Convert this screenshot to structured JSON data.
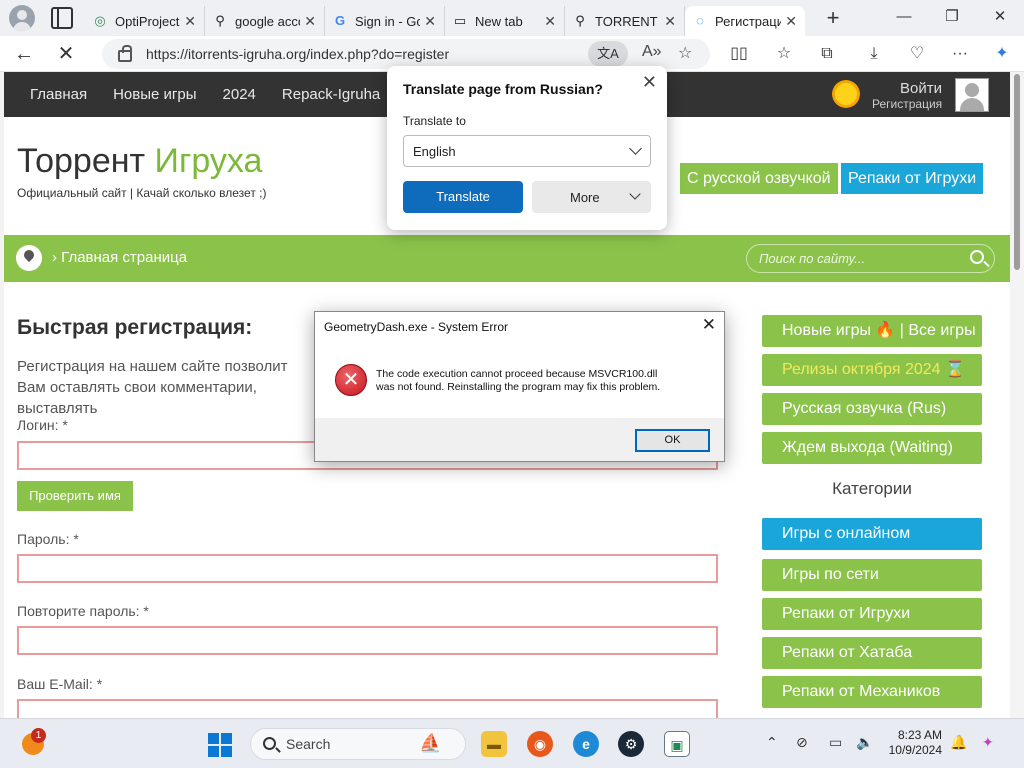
{
  "browser": {
    "tabs": [
      {
        "title": "OptiProject",
        "icon": "optiproject-icon",
        "active": false
      },
      {
        "title": "google account",
        "icon": "search-icon",
        "active": false
      },
      {
        "title": "Sign in - Google",
        "icon": "google-icon",
        "active": false
      },
      {
        "title": "New tab",
        "icon": "newtab-icon",
        "active": false
      },
      {
        "title": "TORRENT I",
        "icon": "search-icon",
        "active": false
      },
      {
        "title": "Регистрация",
        "icon": "loading-icon",
        "active": true
      }
    ],
    "url": "https://itorrents-igruha.org/index.php?do=register"
  },
  "site": {
    "nav": [
      "Главная",
      "Новые игры",
      "2024",
      "Repack-Igruha"
    ],
    "login": "Войти",
    "register": "Регистрация",
    "logo_main": "Торрент ",
    "logo_accent": "Игруха",
    "tagline": "Официальный сайт | Качай сколько влезет ;)",
    "header_buttons": [
      {
        "label": "С русской озвучкой",
        "color": "#8bc34a"
      },
      {
        "label": "Репаки от Игрухи",
        "color": "#1aa6d9"
      }
    ],
    "breadcrumb": "Главная страница",
    "search_placeholder": "Поиск по сайту..."
  },
  "form": {
    "heading": "Быстрая регистрация:",
    "intro": "Регистрация на нашем сайте позволит Вам оставлять свои комментарии, выставлять",
    "login_label": "Логин: *",
    "check_button": "Проверить имя",
    "password_label": "Пароль: *",
    "password_repeat_label": "Повторите пароль: *",
    "email_label": "Ваш E-Mail: *"
  },
  "sidebar": {
    "top_items": [
      {
        "text": "Новые игры 🔥 | Все игры"
      },
      {
        "text": "Релизы октября 2024 ⌛"
      },
      {
        "text": "Русская озвучка (Rus)"
      },
      {
        "text": "Ждем выхода (Waiting)"
      }
    ],
    "categories_heading": "Категории",
    "categories": [
      "Игры с онлайном",
      "Игры по сети",
      "Репаки от Игрухи",
      "Репаки от Хатаба",
      "Репаки от Механиков"
    ]
  },
  "translate_popup": {
    "title": "Translate page from Russian?",
    "label": "Translate to",
    "language": "English",
    "translate_button": "Translate",
    "more_button": "More"
  },
  "error_dialog": {
    "title": "GeometryDash.exe - System Error",
    "message_line1": "The code execution cannot proceed because MSVCR100.dll",
    "message_line2": "was not found. Reinstalling the program may fix this problem.",
    "ok_button": "OK"
  },
  "taskbar": {
    "search": "Search",
    "notification_count": "1",
    "time": "8:23 AM",
    "date": "10/9/2024"
  }
}
